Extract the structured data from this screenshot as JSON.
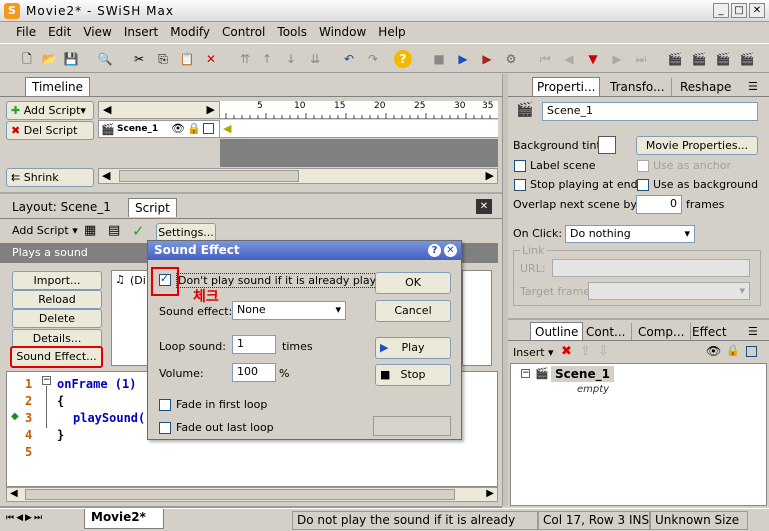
{
  "window": {
    "title": "Movie2* - SWiSH Max",
    "icon": "S"
  },
  "menu": [
    "File",
    "Edit",
    "View",
    "Insert",
    "Modify",
    "Control",
    "Tools",
    "Window",
    "Help"
  ],
  "timeline": {
    "tab": "Timeline",
    "add_script": "Add Script",
    "del_script": "Del Script",
    "shrink": "Shrink",
    "scene_row": "Scene_1",
    "ruler": [
      "5",
      "10",
      "15",
      "20",
      "25",
      "30",
      "35"
    ]
  },
  "script_panel": {
    "tabs": [
      "Layout: Scene_1",
      "Script"
    ],
    "add_script": "Add Script",
    "settings": "Settings...",
    "description": "Plays a sound",
    "buttons": [
      "Import...",
      "Reload",
      "Delete",
      "Details...",
      "Sound Effect..."
    ],
    "list_item": "(Di",
    "line_numbers": [
      "1",
      "2",
      "3",
      "4",
      "5"
    ],
    "code": [
      "onFrame (1)",
      "{",
      "playSound(",
      "}"
    ]
  },
  "dialog": {
    "title": "Sound Effect",
    "dont_play_label": "Don't play sound if it is already playing",
    "annotation": "체크",
    "sound_effect_label": "Sound effect:",
    "sound_effect_value": "None",
    "loop_label": "Loop sound:",
    "loop_value": "1",
    "loop_unit": "times",
    "volume_label": "Volume:",
    "volume_value": "100",
    "volume_unit": "%",
    "fade_in": "Fade in first loop",
    "fade_out": "Fade out last loop",
    "ok": "OK",
    "cancel": "Cancel",
    "play": "Play",
    "stop": "Stop"
  },
  "properties": {
    "tabs": [
      "Properti...",
      "Transfo...",
      "Reshape"
    ],
    "name_value": "Scene_1",
    "bg_tint": "Background tint:",
    "movie_props": "Movie Properties...",
    "label_scene": "Label scene",
    "use_anchor": "Use as anchor",
    "stop_end": "Stop playing at end",
    "use_bg": "Use as background",
    "overlap": "Overlap next scene by:",
    "overlap_value": "0",
    "overlap_unit": "frames",
    "onclick_label": "On Click:",
    "onclick_value": "Do nothing",
    "link_group": "Link",
    "url_label": "URL:",
    "target_label": "Target frame:"
  },
  "outline": {
    "tabs": [
      "Outline",
      "Cont...",
      "Comp...",
      "Effect"
    ],
    "insert": "Insert",
    "scene": "Scene_1",
    "empty": "empty"
  },
  "bottom": {
    "tab": "Movie2*"
  },
  "status": {
    "message": "Do not play the sound if it is already",
    "pos": "Col 17, Row 3 INS",
    "size": "Unknown Size"
  }
}
